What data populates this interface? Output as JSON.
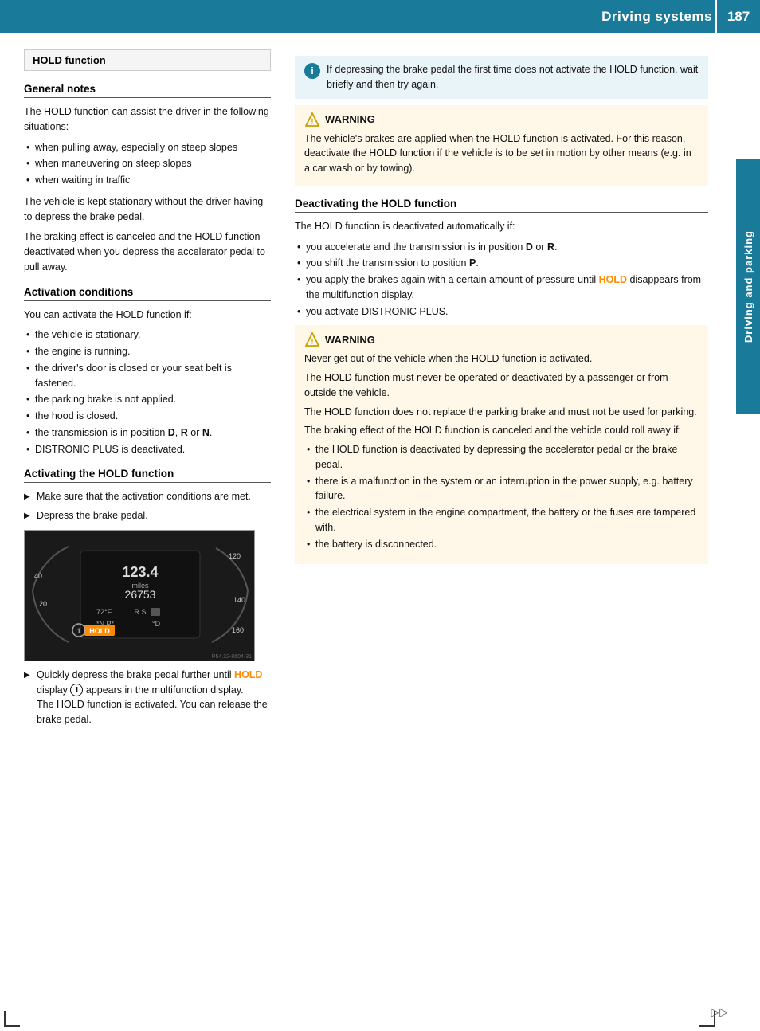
{
  "header": {
    "title": "Driving systems",
    "page_number": "187"
  },
  "side_tab": {
    "label": "Driving and parking"
  },
  "hold_function_box": {
    "title": "HOLD function"
  },
  "left_col": {
    "general_notes_heading": "General notes",
    "general_notes_divider": true,
    "intro_text": "The HOLD function can assist the driver in the following situations:",
    "bullets1": [
      "when pulling away, especially on steep slopes",
      "when maneuvering on steep slopes",
      "when waiting in traffic"
    ],
    "stationary_text": "The vehicle is kept stationary without the driver having to depress the brake pedal.",
    "braking_text": "The braking effect is canceled and the HOLD function deactivated when you depress the accelerator pedal to pull away.",
    "activation_conditions_heading": "Activation conditions",
    "activation_conditions_intro": "You can activate the HOLD function if:",
    "activation_bullets": [
      "the vehicle is stationary.",
      "the engine is running.",
      "the driver's door is closed or your seat belt is fastened.",
      "the parking brake is not applied.",
      "the hood is closed.",
      "the transmission is in position D, R or N.",
      "DISTRONIC PLUS is deactivated."
    ],
    "activating_heading": "Activating the HOLD function",
    "activate_steps": [
      "Make sure that the activation conditions are met.",
      "Depress the brake pedal."
    ],
    "dashboard_caption_part1": "Quickly depress the brake pedal further until ",
    "hold_word1": "HOLD",
    "dashboard_caption_part2": " display ",
    "circle_num": "1",
    "dashboard_caption_part3": " appears in the multifunction display.",
    "dashboard_caption_part4": "The HOLD function is activated. You can release the brake pedal.",
    "dashboard_photo_id": "P54.32-8604-31"
  },
  "right_col": {
    "info_box_text": "If depressing the brake pedal the first time does not activate the HOLD function, wait briefly and then try again.",
    "warning1": {
      "title": "WARNING",
      "lines": [
        "The vehicle's brakes are applied when the HOLD function is activated. For this reason, deactivate the HOLD function if the vehicle is to be set in motion by other means (e.g. in a car wash or by towing)."
      ]
    },
    "deactivating_heading": "Deactivating the HOLD function",
    "deactivating_intro": "The HOLD function is deactivated automatically if:",
    "deactivating_bullets": [
      {
        "text": "you accelerate and the transmission is in position ",
        "bold_part": "D",
        "text2": " or ",
        "bold_part2": "R",
        "text3": "."
      },
      {
        "text": "you shift the transmission to position ",
        "bold_part": "P",
        "text2": ".",
        "bold_part2": "",
        "text3": ""
      },
      {
        "text": "you apply the brakes again with a certain amount of pressure until ",
        "hold_word": "HOLD",
        "text2": " disappears from the multifunction display.",
        "bold_part": "",
        "bold_part2": "",
        "text3": ""
      },
      {
        "text": "you activate DISTRONIC PLUS.",
        "bold_part": "",
        "text2": "",
        "bold_part2": "",
        "text3": ""
      }
    ],
    "warning2": {
      "title": "WARNING",
      "paragraphs": [
        "Never get out of the vehicle when the HOLD function is activated.",
        "The HOLD function must never be operated or deactivated by a passenger or from outside the vehicle.",
        "The HOLD function does not replace the parking brake and must not be used for parking.",
        "The braking effect of the HOLD function is canceled and the vehicle could roll away if:"
      ],
      "final_bullets": [
        "the HOLD function is deactivated by depressing the accelerator pedal or the brake pedal.",
        "there is a malfunction in the system or an interruption in the power supply, e.g. battery failure.",
        "the electrical system in the engine compartment, the battery or the fuses are tampered with.",
        "the battery is disconnected."
      ]
    }
  },
  "forward_arrows": "▷▷"
}
